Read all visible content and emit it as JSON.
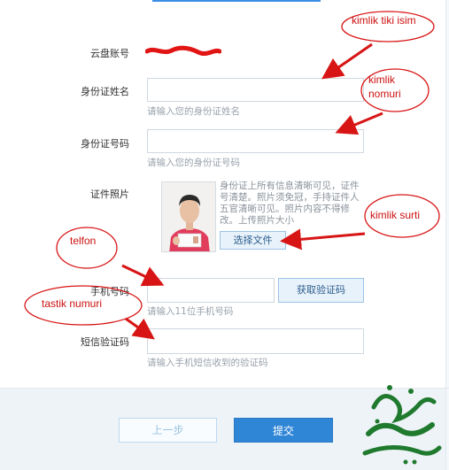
{
  "form": {
    "account_label": "云盘账号",
    "name_label": "身份证姓名",
    "name_hint": "请输入您的身份证姓名",
    "id_label": "身份证号码",
    "id_hint": "请输入您的身份证号码",
    "photo_label": "证件照片",
    "photo_note": "身份证上所有信息清晰可见，证件号清楚。照片须免冠，手持证件人五官清晰可见。照片内容不得修改。上传照片大小",
    "choose_file_label": "选择文件",
    "phone_label": "手机号码",
    "phone_hint": "请输入11位手机号码",
    "get_code_label": "获取验证码",
    "sms_label": "短信验证码",
    "sms_hint": "请输入手机短信收到的验证码"
  },
  "footer": {
    "prev_label": "上一步",
    "submit_label": "提交"
  },
  "annotations": {
    "name_note": "kimlik tiki isim",
    "id_note_line1": "kimlik",
    "id_note_line2": "nomuri",
    "photo_note": "kimlik surti",
    "phone_note": "telfon",
    "sms_note": "tastik numuri",
    "color": "#cc1111"
  },
  "colors": {
    "accent": "#2f86d6",
    "panel_bg": "#ffffff",
    "footer_bg": "#eef3f8"
  }
}
